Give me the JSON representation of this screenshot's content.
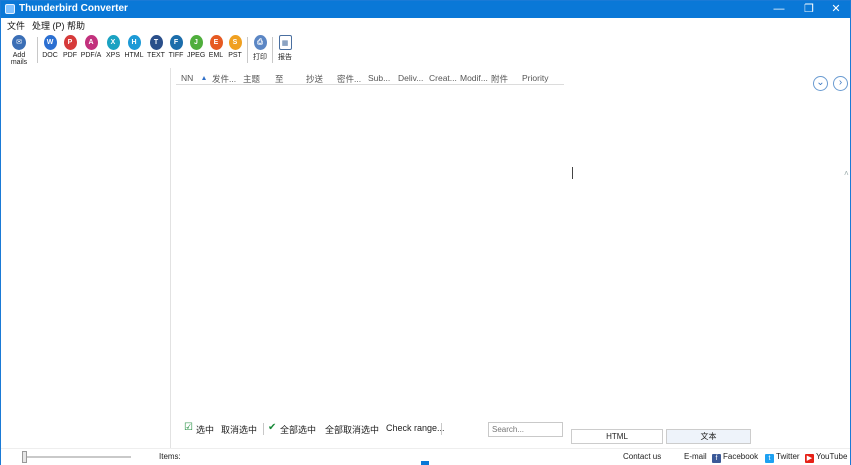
{
  "window": {
    "title": "Thunderbird Converter"
  },
  "titlebar": {
    "minimize": "—",
    "restore": "❐",
    "close": "✕"
  },
  "menu": [
    {
      "label": "文件"
    },
    {
      "label": "处理 (P)"
    },
    {
      "label": "帮助"
    }
  ],
  "toolbar": {
    "add_mails": "Add mails",
    "formats": [
      {
        "label": "DOC",
        "color": "#2b6fd1",
        "glyph": "W"
      },
      {
        "label": "PDF",
        "color": "#d63a3a",
        "glyph": "P"
      },
      {
        "label": "PDF/A",
        "color": "#c2317d",
        "glyph": "A"
      },
      {
        "label": "XPS",
        "color": "#1aa2c2",
        "glyph": "X"
      },
      {
        "label": "HTML",
        "color": "#1d9ad6",
        "glyph": "H"
      },
      {
        "label": "TEXT",
        "color": "#2a4f8a",
        "glyph": "T"
      },
      {
        "label": "TIFF",
        "color": "#1b6dab",
        "glyph": "F"
      },
      {
        "label": "JPEG",
        "color": "#4fae3c",
        "glyph": "J"
      },
      {
        "label": "EML",
        "color": "#e65a22",
        "glyph": "E"
      },
      {
        "label": "PST",
        "color": "#f0a020",
        "glyph": "S"
      }
    ],
    "print": "打印",
    "report": "报告"
  },
  "columns": [
    {
      "label": "NN"
    },
    {
      "label": "发件..."
    },
    {
      "label": "主题"
    },
    {
      "label": "至"
    },
    {
      "label": "抄送"
    },
    {
      "label": "密件..."
    },
    {
      "label": "Sub..."
    },
    {
      "label": "Deliv..."
    },
    {
      "label": "Creat..."
    },
    {
      "label": "Modif..."
    },
    {
      "label": "附件"
    },
    {
      "label": "Priority"
    }
  ],
  "nav": {
    "prev": "⌄",
    "next": "›"
  },
  "bottom_toolbar": {
    "select": "选中",
    "deselect": "取消选中",
    "select_all": "全部选中",
    "deselect_all": "全部取消选中",
    "check_range": "Check range..."
  },
  "search": {
    "placeholder": "Search..."
  },
  "view_tabs": [
    {
      "label": "HTML"
    },
    {
      "label": "文本"
    }
  ],
  "status": {
    "items_label": "Items:",
    "contact_us": "Contact us",
    "email": "E-mail",
    "facebook": "Facebook",
    "twitter": "Twitter",
    "youtube": "YouTube"
  },
  "colors": {
    "titlebar": "#0a78d7",
    "accent": "#1a7ad6"
  }
}
